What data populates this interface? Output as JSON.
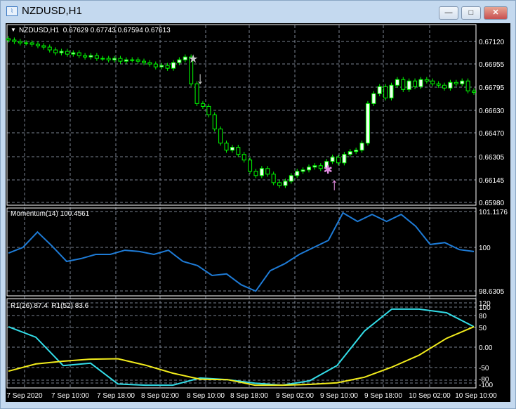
{
  "window": {
    "title": "NZDUSD,H1",
    "minimize": "—",
    "maximize": "□",
    "close": "✕",
    "icon": "chart-window-icon"
  },
  "main": {
    "header": "NZDUSD,H1  0.67629 0.67743 0.67594 0.67613",
    "price_ticks": [
      "0.67120",
      "0.66955",
      "0.66795",
      "0.66630",
      "0.66470",
      "0.66305",
      "0.66145",
      "0.65980"
    ]
  },
  "momentum": {
    "header": "Momentum(14) 100.4561",
    "ticks": [
      "101.1176",
      "100",
      "98.6305"
    ]
  },
  "rsi": {
    "header": "R1(26) 87.4  R1(52) 83.6",
    "ticks": [
      "120",
      "100",
      "80",
      "50",
      "0.00",
      "-50",
      "-80",
      "-100"
    ]
  },
  "time_ticks": [
    "7 Sep 2020",
    "7 Sep 10:00",
    "7 Sep 18:00",
    "8 Sep 02:00",
    "8 Sep 10:00",
    "8 Sep 18:00",
    "9 Sep 02:00",
    "9 Sep 10:00",
    "9 Sep 18:00",
    "10 Sep 02:00",
    "10 Sep 10:00"
  ],
  "colors": {
    "background": "#000000",
    "candle": "#00ff00",
    "grid": "#7a8290",
    "momentum": "#1e7bd6",
    "rsi_fast": "#33dde8",
    "rsi_slow": "#f2ec1c",
    "sell_signal": "#c8c8c8",
    "buy_signal": "#e08be0"
  },
  "chart_data": [
    {
      "type": "candlestick",
      "symbol": "NZDUSD",
      "timeframe": "H1",
      "ylim": [
        0.6598,
        0.6712
      ],
      "close": [
        0.6713,
        0.6712,
        0.6711,
        0.6711,
        0.671,
        0.6709,
        0.6708,
        0.6706,
        0.6704,
        0.6705,
        0.6703,
        0.6704,
        0.6702,
        0.6701,
        0.6702,
        0.67,
        0.67,
        0.6699,
        0.67,
        0.6698,
        0.6699,
        0.6699,
        0.6698,
        0.6697,
        0.6696,
        0.6694,
        0.6695,
        0.6693,
        0.6697,
        0.6699,
        0.6701,
        0.6682,
        0.6668,
        0.6666,
        0.666,
        0.665,
        0.664,
        0.6635,
        0.6637,
        0.6632,
        0.6628,
        0.662,
        0.6617,
        0.6622,
        0.6618,
        0.6612,
        0.661,
        0.6613,
        0.6617,
        0.662,
        0.6621,
        0.6623,
        0.6624,
        0.6622,
        0.6627,
        0.663,
        0.6626,
        0.6632,
        0.6634,
        0.6635,
        0.664,
        0.6668,
        0.6675,
        0.668,
        0.6672,
        0.6681,
        0.6685,
        0.6678,
        0.6684,
        0.668,
        0.6685,
        0.6684,
        0.6682,
        0.6681,
        0.6679,
        0.6683,
        0.6682,
        0.6684,
        0.6677,
        0.6676
      ],
      "signals": [
        {
          "type": "sell",
          "candle_index": 31
        },
        {
          "type": "buy",
          "candle_index": 54
        }
      ]
    },
    {
      "type": "line",
      "name": "Momentum(14)",
      "ylim": [
        98.6305,
        101.1176
      ],
      "values": [
        99.82,
        100.0,
        100.48,
        100.04,
        99.56,
        99.65,
        99.78,
        99.78,
        99.91,
        99.87,
        99.78,
        99.91,
        99.56,
        99.43,
        99.12,
        99.17,
        98.83,
        98.63,
        99.27,
        99.49,
        99.78,
        100.0,
        100.22,
        101.08,
        100.81,
        101.03,
        100.81,
        101.03,
        100.66,
        100.09,
        100.15,
        99.93,
        99.87
      ]
    },
    {
      "type": "line",
      "ylim": [
        -100,
        120
      ],
      "series": [
        {
          "name": "R1(26)",
          "values": [
            51,
            25,
            -46,
            -40,
            -92,
            -95,
            -95,
            -77,
            -81,
            -90,
            -95,
            -84,
            -46,
            40,
            95,
            95,
            86,
            51
          ]
        },
        {
          "name": "R1(52)",
          "values": [
            -60,
            -42,
            -35,
            -30,
            -29,
            -45,
            -65,
            -80,
            -81,
            -95,
            -95,
            -93,
            -89,
            -75,
            -50,
            -20,
            22,
            51
          ]
        }
      ]
    }
  ]
}
